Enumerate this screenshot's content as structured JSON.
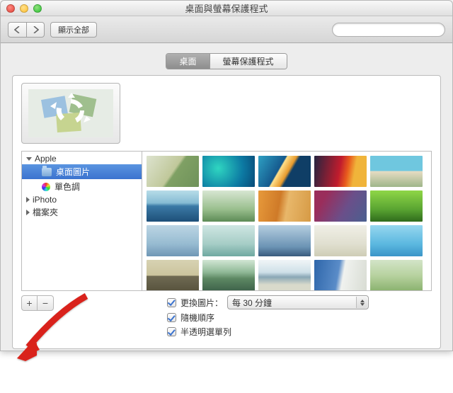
{
  "window": {
    "title": "桌面與螢幕保護程式"
  },
  "toolbar": {
    "showall_label": "顯示全部",
    "search_placeholder": ""
  },
  "tabs": {
    "desktop_label": "桌面",
    "screensaver_label": "螢幕保護程式",
    "active": "desktop"
  },
  "sidebar": {
    "groups": [
      {
        "label": "Apple",
        "expanded": true,
        "children": [
          {
            "label": "桌面圖片",
            "icon": "folder",
            "selected": true
          },
          {
            "label": "單色調",
            "icon": "wheel",
            "selected": false
          }
        ]
      },
      {
        "label": "iPhoto",
        "expanded": false,
        "children": []
      },
      {
        "label": "檔案夾",
        "expanded": false,
        "children": []
      }
    ]
  },
  "addremove": {
    "plus": "+",
    "minus": "−"
  },
  "options": {
    "change_label": "更換圖片：",
    "interval_value": "每 30 分鐘",
    "random_label": "隨機順序",
    "translucent_label": "半透明選單列",
    "change_checked": true,
    "random_checked": true,
    "translucent_checked": true
  }
}
